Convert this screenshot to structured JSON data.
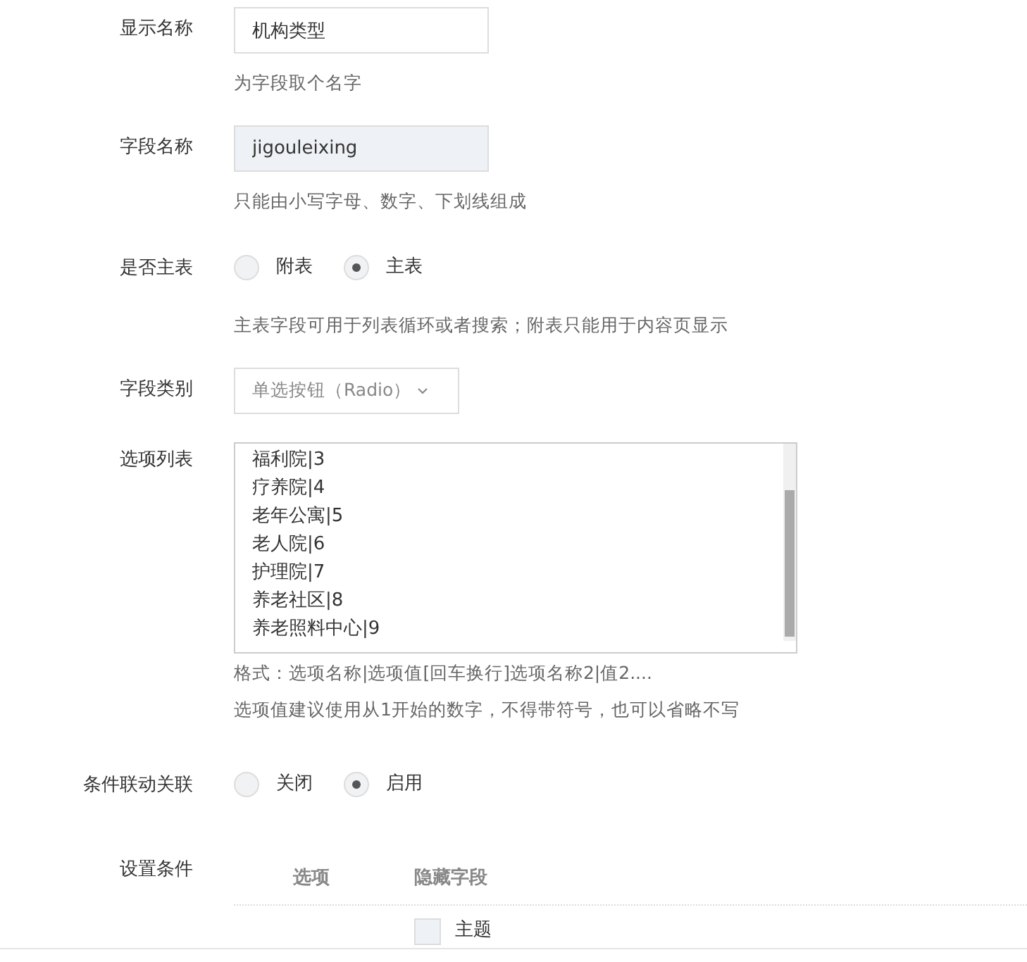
{
  "display_name": {
    "label": "显示名称",
    "value": "机构类型",
    "hint": "为字段取个名字"
  },
  "field_name": {
    "label": "字段名称",
    "value": "jigouleixing",
    "disabled": true,
    "hint": "只能由小写字母、数字、下划线组成"
  },
  "main_table": {
    "label": "是否主表",
    "options": [
      {
        "label": "附表",
        "selected": false
      },
      {
        "label": "主表",
        "selected": true
      }
    ],
    "hint": "主表字段可用于列表循环或者搜索；附表只能用于内容页显示"
  },
  "field_type": {
    "label": "字段类别",
    "value": "单选按钮（Radio）"
  },
  "option_list": {
    "label": "选项列表",
    "lines": [
      "福利院|3",
      "疗养院|4",
      "老年公寓|5",
      "老人院|6",
      "护理院|7",
      "养老社区|8",
      "养老照料中心|9"
    ],
    "hints": [
      "格式：选项名称|选项值[回车换行]选项名称2|值2....",
      "选项值建议使用从1开始的数字，不得带符号，也可以省略不写"
    ]
  },
  "linkage": {
    "label": "条件联动关联",
    "options": [
      {
        "label": "关闭",
        "selected": false
      },
      {
        "label": "启用",
        "selected": true
      }
    ]
  },
  "conditions": {
    "label": "设置条件",
    "columns": [
      "选项",
      "隐藏字段"
    ],
    "rows": [
      {
        "field": "主题",
        "checked": false
      }
    ]
  }
}
